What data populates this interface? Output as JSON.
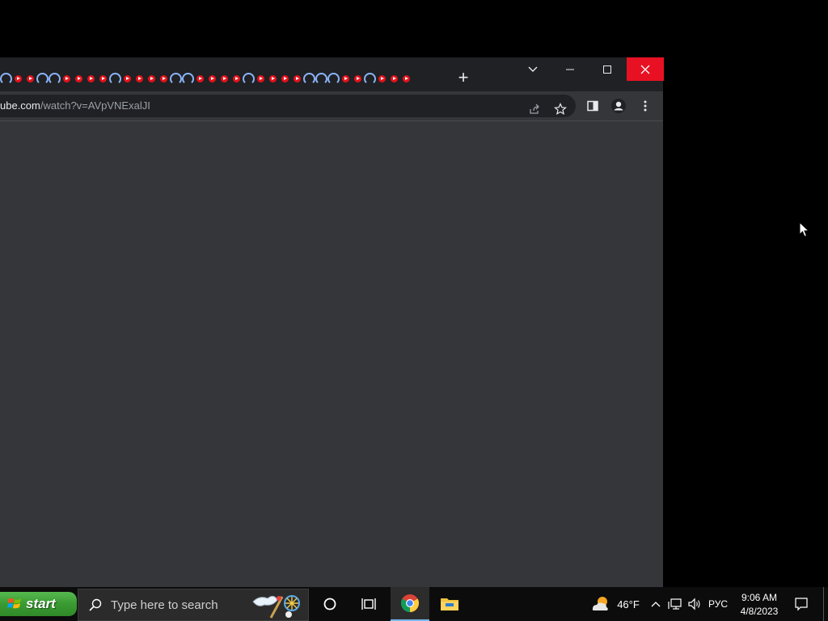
{
  "browser": {
    "url_host": "ube.com",
    "url_path": "/watch?v=AVpVNExalJI",
    "tab_count": 34
  },
  "taskbar": {
    "start_label": "start",
    "search_placeholder": "Type here to search",
    "weather_temp": "46°F",
    "language": "РУС",
    "time": "9:06 AM",
    "date": "4/8/2023"
  },
  "icons": {
    "tab_favicon": "youtube-icon",
    "new_tab": "plus-icon",
    "tab_search": "chevron-down-icon",
    "share": "share-icon",
    "bookmark": "star-icon",
    "side_panel": "side-panel-icon",
    "profile": "profile-icon",
    "menu": "more-vert-icon"
  },
  "colors": {
    "close_button": "#e81123",
    "start_button": "#3a9a32",
    "browser_bg": "#35363a",
    "tabstrip_bg": "#202124"
  }
}
